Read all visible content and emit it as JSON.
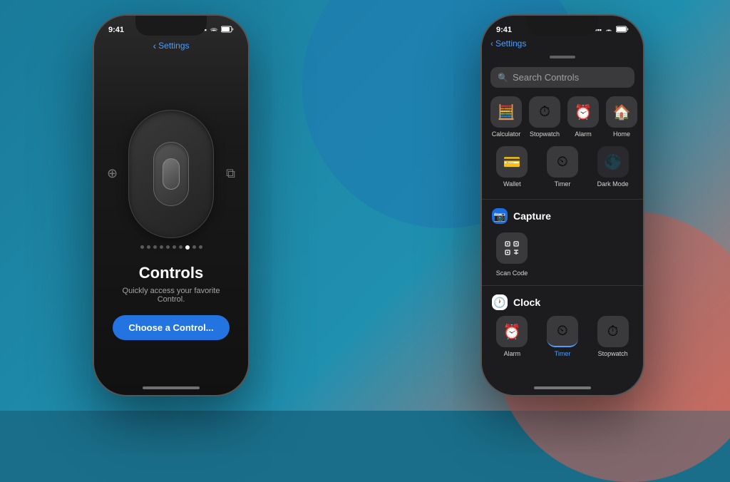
{
  "background": {
    "color": "#1a7a9a"
  },
  "left_phone": {
    "status_bar": {
      "time": "9:41",
      "signal": "●●●",
      "wifi": "WiFi",
      "battery": "Battery"
    },
    "back_label": "Settings",
    "dots_count": 10,
    "active_dot": 7,
    "title": "Controls",
    "subtitle": "Quickly access your favorite Control.",
    "button_label": "Choose a Control..."
  },
  "right_phone": {
    "status_bar": {
      "time": "9:41",
      "signal": "●●●",
      "wifi": "WiFi",
      "battery": "Battery"
    },
    "back_label": "Settings",
    "search_placeholder": "Search Controls",
    "grid_row1": [
      {
        "icon": "🧮",
        "label": "Calculator"
      },
      {
        "icon": "⏱",
        "label": "Stopwatch"
      },
      {
        "icon": "⏰",
        "label": "Alarm"
      },
      {
        "icon": "🏠",
        "label": "Home"
      }
    ],
    "grid_row2": [
      {
        "icon": "💳",
        "label": "Wallet"
      },
      {
        "icon": "⏲",
        "label": "Timer"
      },
      {
        "icon": "🌑",
        "label": "Dark Mode"
      }
    ],
    "section_capture": {
      "icon": "📷",
      "label": "Capture",
      "icon_bg": "#1a6ee0",
      "items": [
        {
          "icon": "⬛",
          "label": "Scan Code"
        }
      ]
    },
    "section_clock": {
      "icon": "🕐",
      "label": "Clock",
      "icon_bg": "#ffffff",
      "items": [
        {
          "icon": "⏰",
          "label": "Alarm"
        },
        {
          "icon": "⏲",
          "label": "Timer"
        },
        {
          "icon": "⏱",
          "label": "Stopwatch"
        }
      ]
    }
  }
}
